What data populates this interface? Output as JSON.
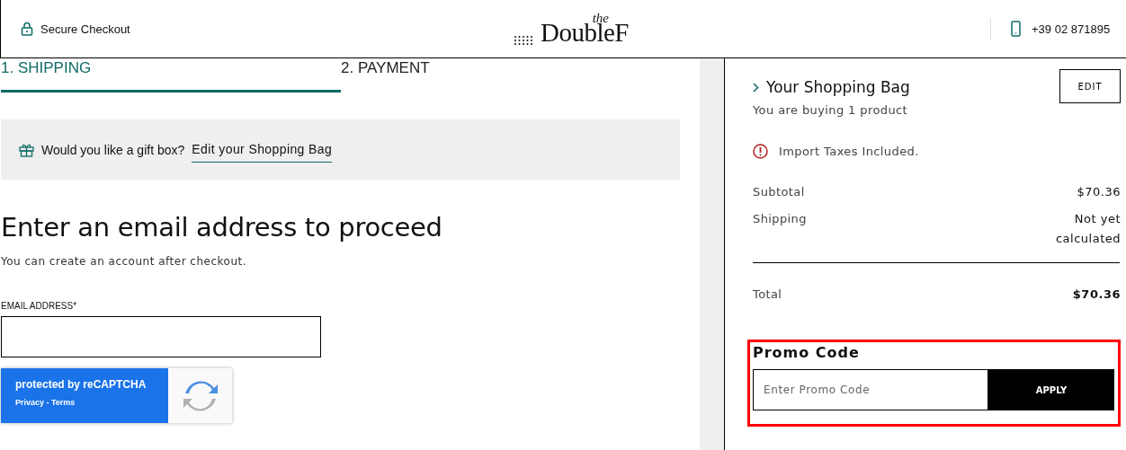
{
  "header": {
    "secure_label": "Secure Checkout",
    "logo": {
      "small": "the",
      "main": "DoubleF"
    },
    "phone": "+39 02 871895"
  },
  "steps": [
    {
      "label": "1. SHIPPING",
      "selected": true
    },
    {
      "label": "2. PAYMENT",
      "selected": false
    }
  ],
  "gift_banner": {
    "text": "Would you like a gift box?",
    "link": "Edit your Shopping Bag"
  },
  "email_section": {
    "heading": "Enter an email address to proceed",
    "subtitle": "You can create an account after checkout.",
    "field_label": "EMAIL ADDRESS*"
  },
  "recaptcha": {
    "title": "protected by reCAPTCHA",
    "links": "Privacy - Terms"
  },
  "summary": {
    "title": "Your Shopping Bag",
    "subtitle": "You are buying 1 product",
    "edit_button": "EDIT",
    "notice": "Import Taxes Included.",
    "lines": [
      {
        "label": "Subtotal",
        "value": "$70.36"
      },
      {
        "label": "Shipping",
        "value": "Not yet calculated"
      }
    ],
    "total": {
      "label": "Total",
      "value": "$70.36"
    },
    "promo": {
      "title": "Promo Code",
      "placeholder": "Enter Promo Code",
      "button": "APPLY"
    }
  }
}
